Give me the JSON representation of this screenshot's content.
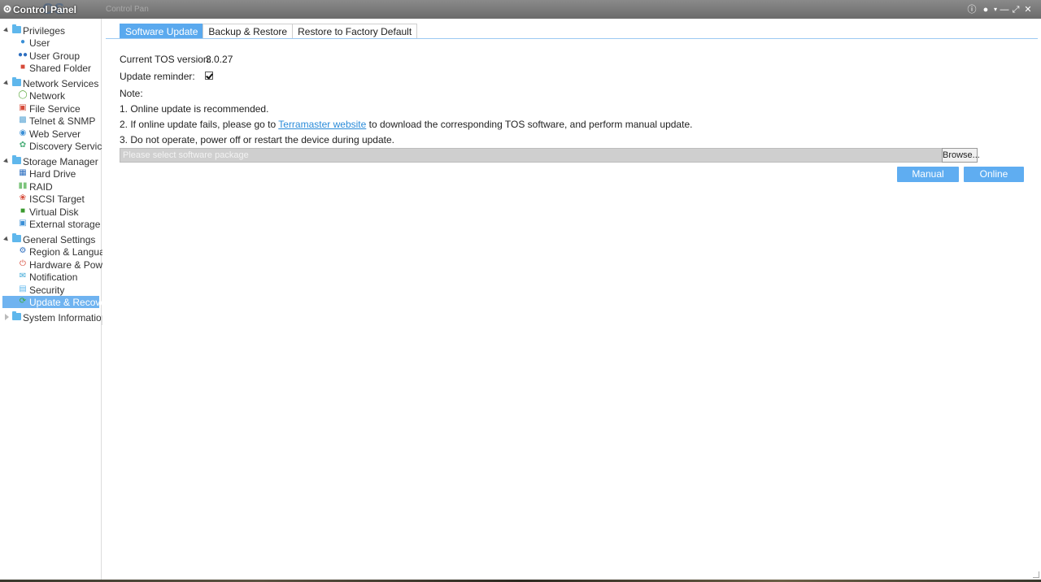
{
  "window": {
    "title": "Control Panel",
    "logo_text": "OS",
    "ghost_title": "Control Pan"
  },
  "sidebar": {
    "groups": [
      {
        "label": "Privileges",
        "expanded": true,
        "items": [
          {
            "label": "User",
            "icon": "user-icon"
          },
          {
            "label": "User Group",
            "icon": "user-group-icon"
          },
          {
            "label": "Shared Folder",
            "icon": "shared-folder-icon"
          }
        ]
      },
      {
        "label": "Network Services",
        "expanded": true,
        "items": [
          {
            "label": "Network",
            "icon": "globe-icon"
          },
          {
            "label": "File Service",
            "icon": "file-service-icon"
          },
          {
            "label": "Telnet & SNMP",
            "icon": "telnet-icon"
          },
          {
            "label": "Web Server",
            "icon": "web-server-icon"
          },
          {
            "label": "Discovery Service",
            "icon": "discovery-icon"
          }
        ]
      },
      {
        "label": "Storage Manager",
        "expanded": true,
        "items": [
          {
            "label": "Hard Drive",
            "icon": "hard-drive-icon"
          },
          {
            "label": "RAID",
            "icon": "raid-icon"
          },
          {
            "label": "ISCSI Target",
            "icon": "iscsi-icon"
          },
          {
            "label": "Virtual Disk",
            "icon": "virtual-disk-icon"
          },
          {
            "label": "External storage",
            "icon": "external-storage-icon"
          }
        ]
      },
      {
        "label": "General Settings",
        "expanded": true,
        "items": [
          {
            "label": "Region & Language",
            "icon": "gear-icon"
          },
          {
            "label": "Hardware & Power",
            "icon": "power-icon"
          },
          {
            "label": "Notification",
            "icon": "notification-icon"
          },
          {
            "label": "Security",
            "icon": "security-icon"
          },
          {
            "label": "Update & Recovery",
            "icon": "update-icon",
            "selected": true
          }
        ]
      },
      {
        "label": "System Information",
        "expanded": false,
        "items": []
      }
    ]
  },
  "tabs": [
    {
      "label": "Software Update",
      "active": true
    },
    {
      "label": "Backup & Restore",
      "active": false
    },
    {
      "label": "Restore to Factory Default",
      "active": false
    }
  ],
  "software_update": {
    "version_label": "Current TOS version:",
    "version_value": "3.0.27",
    "reminder_label": "Update reminder:",
    "reminder_checked": true,
    "note_label": "Note:",
    "note1": "1. Online update is recommended.",
    "note2_prefix": "2. If online update fails, please go to ",
    "note2_link": "Terramaster website",
    "note2_suffix": " to download the corresponding TOS software, and perform manual update.",
    "note3": "3. Do not operate, power off or restart the device during update.",
    "file_placeholder": "Please select software package",
    "browse_label": "Browse...",
    "manual_update_label": "Manual update",
    "online_update_label": "Online update"
  },
  "colors": {
    "accent": "#5aa9ee",
    "selected_bg": "#6fb3f0",
    "titlebar": "#7a7a7a"
  }
}
